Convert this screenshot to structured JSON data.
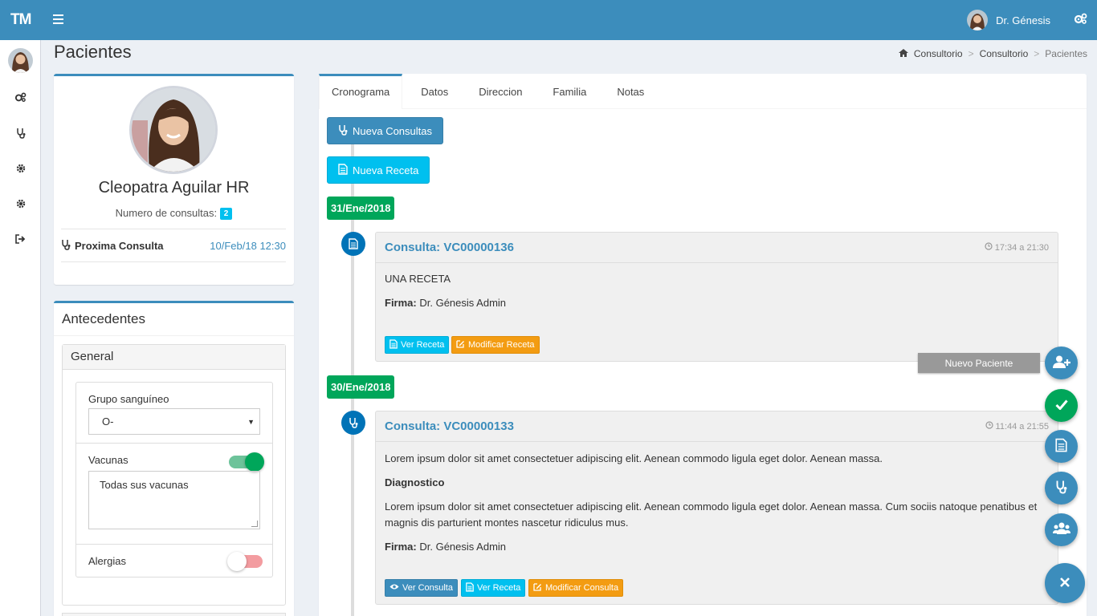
{
  "app": {
    "logo": "TM"
  },
  "topbar": {
    "user_name": "Dr. Génesis"
  },
  "page": {
    "title": "Pacientes"
  },
  "breadcrumb": {
    "items": [
      "Consultorio",
      "Consultorio"
    ],
    "active": "Pacientes",
    "separator": ">"
  },
  "profile": {
    "name": "Cleopatra Aguilar HR",
    "consult_label": "Numero de consultas:",
    "consult_count": "2",
    "next_label": "Proxima Consulta",
    "next_date": "10/Feb/18 12:30"
  },
  "antecedentes": {
    "title": "Antecedentes",
    "panel_title": "General",
    "blood_label": "Grupo sanguíneo",
    "blood_value": "O-",
    "vacunas_label": "Vacunas",
    "vacunas_on": true,
    "vacunas_text": "Todas sus vacunas",
    "alergias_label": "Alergias",
    "alergias_on": false
  },
  "tabs": [
    "Cronograma",
    "Datos",
    "Direccion",
    "Familia",
    "Notas"
  ],
  "actions": {
    "new_consult": "Nueva Consultas",
    "new_recipe": "Nueva Receta"
  },
  "timeline": [
    {
      "date": "31/Ene/2018",
      "title": "Consulta: VC00000136",
      "time": "17:34 a 21:30",
      "text": "UNA RECETA",
      "firma_label": "Firma:",
      "firma": "Dr. Génesis Admin",
      "btn_ver_receta": "Ver Receta",
      "btn_modificar": "Modificar Receta"
    },
    {
      "date": "30/Ene/2018",
      "title": "Consulta: VC00000133",
      "time": "11:44 a 21:55",
      "text": "Lorem ipsum dolor sit amet consectetuer adipiscing elit. Aenean commodo ligula eget dolor. Aenean massa.",
      "diag_label": "Diagnostico",
      "diag_text": "Lorem ipsum dolor sit amet consectetuer adipiscing elit. Aenean commodo ligula eget dolor. Aenean massa. Cum sociis natoque penatibus et magnis dis parturient montes nascetur ridiculus mus.",
      "firma_label": "Firma:",
      "firma": "Dr. Génesis Admin",
      "btn_ver_consulta": "Ver Consulta",
      "btn_ver_receta": "Ver Receta",
      "btn_modificar": "Modificar Consulta"
    }
  ],
  "fab": {
    "tooltip": "Nuevo Paciente"
  },
  "colors": {
    "primary": "#3c8dbc",
    "success": "#00a65a",
    "info": "#00c0ef",
    "warning": "#f39c12",
    "danger_soft": "#f39ca0"
  }
}
